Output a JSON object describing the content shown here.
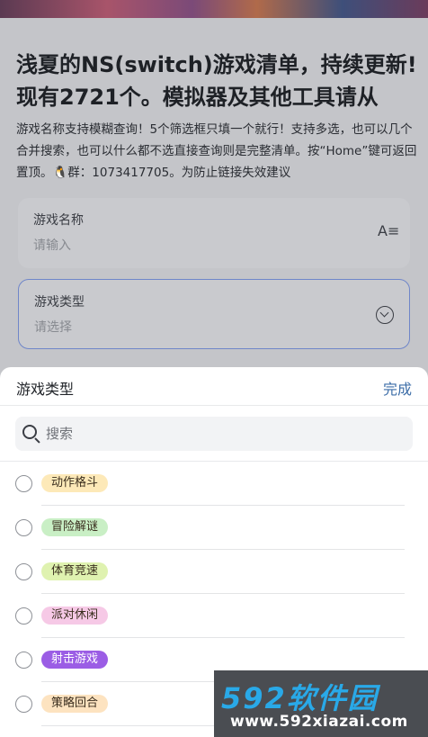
{
  "page": {
    "title": "浅夏的NS(switch)游戏清单，持续更新!现有2721个。模拟器及其他工具请从",
    "description": "游戏名称支持模糊查询！5个筛选框只填一个就行！支持多选，也可以几个合并搜索，也可以什么都不选直接查询则是完整清单。按“Home”键可返回置顶。🐧群：1073417705。为防止链接失效建议"
  },
  "form": {
    "name_label": "游戏名称",
    "name_placeholder": "请输入",
    "type_label": "游戏类型",
    "type_placeholder": "请选择"
  },
  "sheet": {
    "title": "游戏类型",
    "done": "完成",
    "search_placeholder": "搜索",
    "options": [
      {
        "label": "动作格斗",
        "color": "#fde9b8"
      },
      {
        "label": "冒险解谜",
        "color": "#c9efc5"
      },
      {
        "label": "体育竞速",
        "color": "#dff2b0"
      },
      {
        "label": "派对休闲",
        "color": "#f6c9e6"
      },
      {
        "label": "射击游戏",
        "color": "#9b5de5",
        "text_color": "#ffffff"
      },
      {
        "label": "策略回合",
        "color": "#fde3c0"
      }
    ]
  },
  "watermark": {
    "logo": "592软件园",
    "url": "www.592xiazai.com"
  }
}
